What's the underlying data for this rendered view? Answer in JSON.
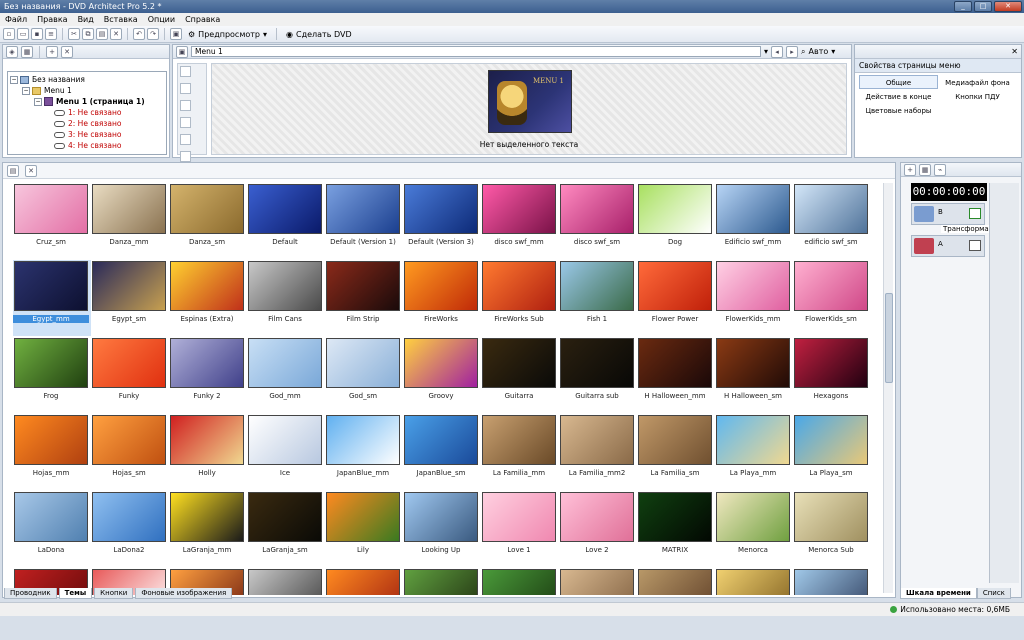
{
  "window": {
    "title": "Без названия - DVD Architect Pro 5.2 *"
  },
  "menubar": [
    "Файл",
    "Правка",
    "Вид",
    "Вставка",
    "Опции",
    "Справка"
  ],
  "toolbar": {
    "preview_label": "Предпросмотр",
    "make_dvd_label": "Сделать DVD"
  },
  "tree": {
    "root": "Без названия",
    "menu": "Menu 1",
    "page": "Menu 1 (страница 1)",
    "links": [
      "1: Не связано",
      "2: Не связано",
      "3: Не связано",
      "4: Не связано"
    ]
  },
  "preview": {
    "menu_selector": "Menu 1",
    "zoom": "Авто",
    "thumb_title": "MENU 1",
    "caption": "Нет выделенного текста"
  },
  "props": {
    "title": "Свойства страницы меню",
    "tabs": [
      "Общие",
      "Медиафайл фона",
      "Действие в конце",
      "Кнопки ПДУ",
      "Цветовые наборы"
    ]
  },
  "themes": [
    {
      "name": "Cruz_sm",
      "c1": "#f7c6dd",
      "c2": "#e36fa5"
    },
    {
      "name": "Danza_mm",
      "c1": "#e9dcc2",
      "c2": "#8a7250"
    },
    {
      "name": "Danza_sm",
      "c1": "#d4b36c",
      "c2": "#8b6a2d"
    },
    {
      "name": "Default",
      "c1": "#3a5fd0",
      "c2": "#0a1a6a"
    },
    {
      "name": "Default (Version 1)",
      "c1": "#7aa0e0",
      "c2": "#1b3f8f"
    },
    {
      "name": "Default (Version 3)",
      "c1": "#4a7bd8",
      "c2": "#0d2a78"
    },
    {
      "name": "disco swf_mm",
      "c1": "#ff5aa8",
      "c2": "#7a1248"
    },
    {
      "name": "disco swf_sm",
      "c1": "#ff8ac0",
      "c2": "#a8206a"
    },
    {
      "name": "Dog",
      "c1": "#a8e060",
      "c2": "#ffffff"
    },
    {
      "name": "Edificio swf_mm",
      "c1": "#b7d4f5",
      "c2": "#2d5a8f"
    },
    {
      "name": "edificio swf_sm",
      "c1": "#d3e6f8",
      "c2": "#50739a"
    },
    {
      "name": "Egypt_mm",
      "c1": "#2b336e",
      "c2": "#0d1030"
    },
    {
      "name": "Egypt_sm",
      "c1": "#2a2a5a",
      "c2": "#c7a050"
    },
    {
      "name": "Espinas (Extra)",
      "c1": "#ffd030",
      "c2": "#c0301a"
    },
    {
      "name": "Film Cans",
      "c1": "#c8c8c8",
      "c2": "#4a4a4a"
    },
    {
      "name": "Film Strip",
      "c1": "#8a2a1a",
      "c2": "#1a0a0a"
    },
    {
      "name": "FireWorks",
      "c1": "#ff9a20",
      "c2": "#c02a08"
    },
    {
      "name": "FireWorks Sub",
      "c1": "#ff7a30",
      "c2": "#b02010"
    },
    {
      "name": "Fish 1",
      "c1": "#9ac8e8",
      "c2": "#3a6a48"
    },
    {
      "name": "Flower Power",
      "c1": "#ff6a3a",
      "c2": "#c0200a"
    },
    {
      "name": "FlowerKids_mm",
      "c1": "#ffd0e4",
      "c2": "#e060a0"
    },
    {
      "name": "FlowerKids_sm",
      "c1": "#ffb0d0",
      "c2": "#d04888"
    },
    {
      "name": "Frog",
      "c1": "#70b040",
      "c2": "#204010"
    },
    {
      "name": "Funky",
      "c1": "#ff7a40",
      "c2": "#e03010"
    },
    {
      "name": "Funky 2",
      "c1": "#b0b0d8",
      "c2": "#40408a"
    },
    {
      "name": "God_mm",
      "c1": "#c8dff5",
      "c2": "#7aa8d8"
    },
    {
      "name": "God_sm",
      "c1": "#dde8f5",
      "c2": "#8ab0d8"
    },
    {
      "name": "Groovy",
      "c1": "#ffd040",
      "c2": "#a020a0"
    },
    {
      "name": "Guitarra",
      "c1": "#3a2a10",
      "c2": "#0a0a08"
    },
    {
      "name": "Guitarra sub",
      "c1": "#2a2010",
      "c2": "#080806"
    },
    {
      "name": "H Halloween_mm",
      "c1": "#6a2a10",
      "c2": "#1a0808"
    },
    {
      "name": "H Halloween_sm",
      "c1": "#8a3a14",
      "c2": "#200a06"
    },
    {
      "name": "Hexagons",
      "c1": "#c02040",
      "c2": "#200010"
    },
    {
      "name": "Hojas_mm",
      "c1": "#ff8a20",
      "c2": "#b04010"
    },
    {
      "name": "Hojas_sm",
      "c1": "#ffa040",
      "c2": "#c05010"
    },
    {
      "name": "Holly",
      "c1": "#d02020",
      "c2": "#f0d890"
    },
    {
      "name": "Ice",
      "c1": "#ffffff",
      "c2": "#b8c8e0"
    },
    {
      "name": "JapanBlue_mm",
      "c1": "#60b0f0",
      "c2": "#ffffff"
    },
    {
      "name": "JapanBlue_sm",
      "c1": "#4aa0e8",
      "c2": "#1a4a9a"
    },
    {
      "name": "La Familia_mm",
      "c1": "#c8a070",
      "c2": "#6a4a28"
    },
    {
      "name": "La Familia_mm2",
      "c1": "#d8b890",
      "c2": "#8a6a48"
    },
    {
      "name": "La Familia_sm",
      "c1": "#c09868",
      "c2": "#705030"
    },
    {
      "name": "La Playa_mm",
      "c1": "#60b8f0",
      "c2": "#f0d890"
    },
    {
      "name": "La Playa_sm",
      "c1": "#4aa8e8",
      "c2": "#e8c878"
    },
    {
      "name": "LaDona",
      "c1": "#a8c8e8",
      "c2": "#5080b0"
    },
    {
      "name": "LaDona2",
      "c1": "#90c0f0",
      "c2": "#3070c0"
    },
    {
      "name": "LaGranja_mm",
      "c1": "#ffe020",
      "c2": "#1a1a1a"
    },
    {
      "name": "LaGranja_sm",
      "c1": "#3a2a10",
      "c2": "#0a0a06"
    },
    {
      "name": "Lily",
      "c1": "#ff8a20",
      "c2": "#3a7a20"
    },
    {
      "name": "Looking Up",
      "c1": "#a0c8f0",
      "c2": "#3a5a80"
    },
    {
      "name": "Love 1",
      "c1": "#ffd0e0",
      "c2": "#f088b0"
    },
    {
      "name": "Love 2",
      "c1": "#ffc0d8",
      "c2": "#e07098"
    },
    {
      "name": "MATRIX",
      "c1": "#104010",
      "c2": "#020802"
    },
    {
      "name": "Menorca",
      "c1": "#f0e8c0",
      "c2": "#70a040"
    },
    {
      "name": "Menorca Sub",
      "c1": "#e8e0b8",
      "c2": "#a09060"
    },
    {
      "name": "",
      "c1": "#c02020",
      "c2": "#600808"
    },
    {
      "name": "",
      "c1": "#e85a5a",
      "c2": "#ffffff"
    },
    {
      "name": "",
      "c1": "#ffa040",
      "c2": "#702010"
    },
    {
      "name": "",
      "c1": "#c8c8c8",
      "c2": "#404040"
    },
    {
      "name": "",
      "c1": "#ff8a20",
      "c2": "#a02010"
    },
    {
      "name": "",
      "c1": "#60a040",
      "c2": "#203010"
    },
    {
      "name": "",
      "c1": "#4a9a3a",
      "c2": "#1a3a10"
    },
    {
      "name": "",
      "c1": "#d8b890",
      "c2": "#806040"
    },
    {
      "name": "",
      "c1": "#b89868",
      "c2": "#604028"
    },
    {
      "name": "",
      "c1": "#f0d070",
      "c2": "#806020"
    },
    {
      "name": "",
      "c1": "#a0c8e8",
      "c2": "#304060"
    }
  ],
  "bottom_tabs": [
    "Проводник",
    "Темы",
    "Кнопки",
    "Фоновые изображения"
  ],
  "timeline": {
    "timecode": "00:00:00:00",
    "track_b": "B",
    "track_a": "A",
    "transition": "Трансформа",
    "tabs": [
      "Шкала времени",
      "Списк"
    ]
  },
  "status": {
    "disk": "Использовано места: 0,6МБ"
  }
}
